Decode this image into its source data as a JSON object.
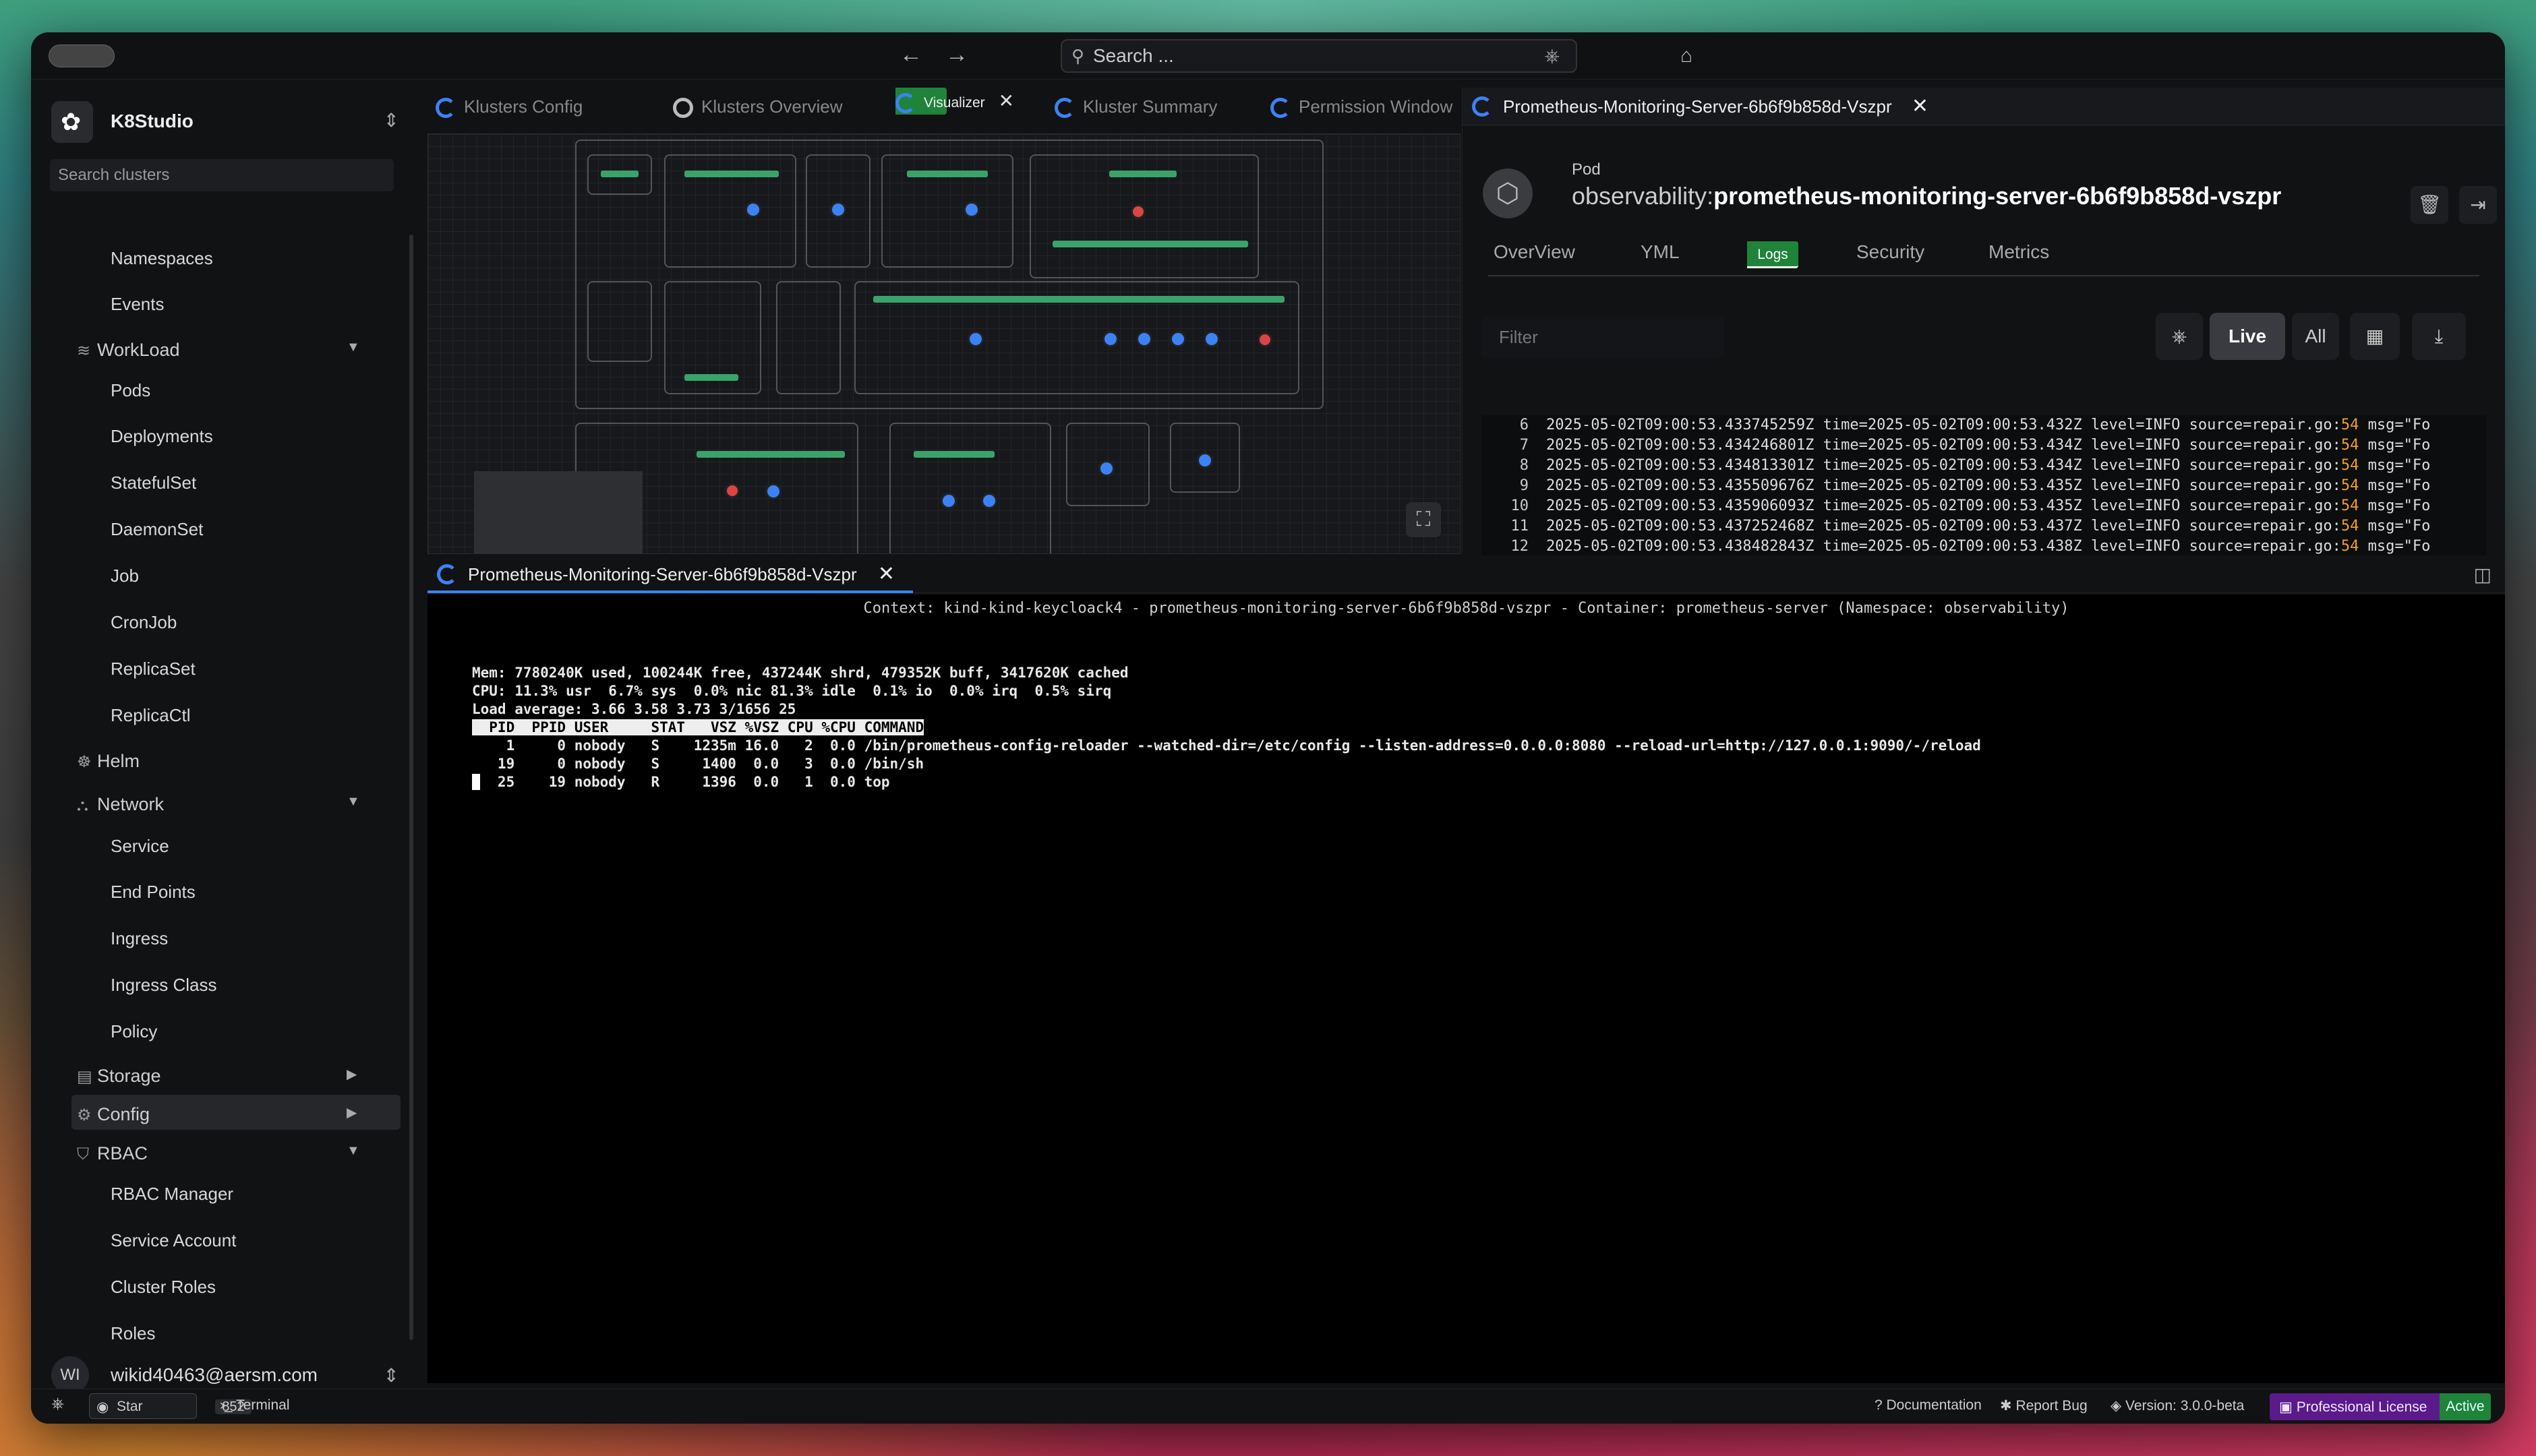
{
  "app": {
    "name": "K8Studio"
  },
  "topbar": {
    "search_placeholder": "Search ...",
    "back": "←",
    "forward": "→"
  },
  "sidebar": {
    "search_placeholder": "Search clusters",
    "items": [
      {
        "label": "Namespaces"
      },
      {
        "label": "Events"
      }
    ],
    "workload": {
      "label": "WorkLoad",
      "items": [
        "Pods",
        "Deployments",
        "StatefulSet",
        "DaemonSet",
        "Job",
        "CronJob",
        "ReplicaSet",
        "ReplicaCtl"
      ]
    },
    "helm": {
      "label": "Helm"
    },
    "network": {
      "label": "Network",
      "items": [
        "Service",
        "End Points",
        "Ingress",
        "Ingress Class",
        "Policy"
      ]
    },
    "storage": {
      "label": "Storage"
    },
    "config": {
      "label": "Config"
    },
    "rbac": {
      "label": "RBAC",
      "items": [
        "RBAC Manager",
        "Service Account",
        "Cluster Roles",
        "Roles"
      ]
    },
    "user": {
      "initials": "WI",
      "email": "wikid40463@aersm.com"
    }
  },
  "tabs": [
    {
      "label": "Klusters Config"
    },
    {
      "label": "Klusters Overview"
    },
    {
      "label": "Visualizer",
      "close": "✕"
    },
    {
      "label": "Kluster Summary"
    },
    {
      "label": "Permission Window"
    }
  ],
  "pod": {
    "tab_label": "Prometheus-Monitoring-Server-6b6f9b858d-Vszpr",
    "close": "✕",
    "type": "Pod",
    "namespace": "observability:",
    "name": "prometheus-monitoring-server-6b6f9b858d-vszpr",
    "subtabs": [
      "OverView",
      "YML",
      "Logs",
      "Security",
      "Metrics"
    ],
    "active_subtab": "Logs",
    "filter_placeholder": "Filter",
    "buttons": {
      "live": "Live",
      "all": "All"
    },
    "logs": [
      {
        "n": "6",
        "ts": "2025-05-02T09:00:53.433745259Z",
        "time": "time=2025-05-02T09:00:53.432Z",
        "level": "level=INFO",
        "src": "source=repair.go:",
        "line": "54",
        "msg": "msg=\"Fo"
      },
      {
        "n": "7",
        "ts": "2025-05-02T09:00:53.434246801Z",
        "time": "time=2025-05-02T09:00:53.434Z",
        "level": "level=INFO",
        "src": "source=repair.go:",
        "line": "54",
        "msg": "msg=\"Fo"
      },
      {
        "n": "8",
        "ts": "2025-05-02T09:00:53.434813301Z",
        "time": "time=2025-05-02T09:00:53.434Z",
        "level": "level=INFO",
        "src": "source=repair.go:",
        "line": "54",
        "msg": "msg=\"Fo"
      },
      {
        "n": "9",
        "ts": "2025-05-02T09:00:53.435509676Z",
        "time": "time=2025-05-02T09:00:53.435Z",
        "level": "level=INFO",
        "src": "source=repair.go:",
        "line": "54",
        "msg": "msg=\"Fo"
      },
      {
        "n": "10",
        "ts": "2025-05-02T09:00:53.435906093Z",
        "time": "time=2025-05-02T09:00:53.435Z",
        "level": "level=INFO",
        "src": "source=repair.go:",
        "line": "54",
        "msg": "msg=\"Fo"
      },
      {
        "n": "11",
        "ts": "2025-05-02T09:00:53.437252468Z",
        "time": "time=2025-05-02T09:00:53.437Z",
        "level": "level=INFO",
        "src": "source=repair.go:",
        "line": "54",
        "msg": "msg=\"Fo"
      },
      {
        "n": "12",
        "ts": "2025-05-02T09:00:53.438482843Z",
        "time": "time=2025-05-02T09:00:53.438Z",
        "level": "level=INFO",
        "src": "source=repair.go:",
        "line": "54",
        "msg": "msg=\"Fo"
      }
    ]
  },
  "terminal": {
    "tab_label": "Prometheus-Monitoring-Server-6b6f9b858d-Vszpr",
    "close": "✕",
    "context": "Context: kind-kind-keycloack4 - prometheus-monitoring-server-6b6f9b858d-vszpr - Container: prometheus-server (Namespace: observability)",
    "lines": [
      "Mem: 7780240K used, 100244K free, 437244K shrd, 479352K buff, 3417620K cached",
      "CPU: 11.3% usr  6.7% sys  0.0% nic 81.3% idle  0.1% io  0.0% irq  0.5% sirq",
      "Load average: 3.66 3.58 3.73 3/1656 25",
      "  PID  PPID USER     STAT   VSZ %VSZ CPU %CPU COMMAND",
      "    1     0 nobody   S    1235m 16.0   2  0.0 /bin/prometheus-config-reloader --watched-dir=/etc/config --listen-address=0.0.0.0:8080 --reload-url=http://127.0.0.1:9090/-/reload",
      "   19     0 nobody   S     1400  0.0   3  0.0 /bin/sh",
      "   25    19 nobody   R     1396  0.0   1  0.0 top"
    ]
  },
  "statusbar": {
    "star": "Star",
    "star_count": "852",
    "terminal": "Terminal",
    "documentation": "Documentation",
    "report_bug": "Report Bug",
    "version": "Version: 3.0.0-beta",
    "license": "Professional License",
    "active": "Active"
  }
}
